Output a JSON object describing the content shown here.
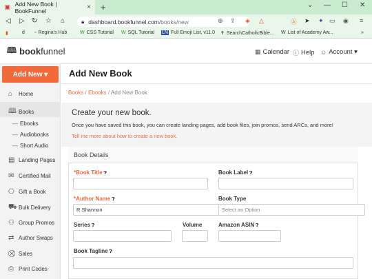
{
  "browser": {
    "tab_title": "Add New Book | BookFunnel",
    "tab_close": "×",
    "new_tab": "+",
    "url_domain": "dashboard.bookfunnel.com",
    "url_path": "/books/new",
    "window_controls": [
      "⌄",
      "—",
      "☐",
      "✕"
    ],
    "bookmarks": [
      {
        "icon": "orange-app-icon",
        "label": ""
      },
      {
        "icon": "d-icon",
        "label": "d"
      },
      {
        "icon": "bookmark-icon",
        "label": "Regina's Hub"
      },
      {
        "icon": "w-icon",
        "label": "CSS Tutorial"
      },
      {
        "icon": "w-icon",
        "label": "SQL Tutorial"
      },
      {
        "icon": "ln-icon",
        "label": "Full Emoji List, v11.0"
      },
      {
        "icon": "cross-icon",
        "label": "SearchCatholicBible..."
      },
      {
        "icon": "w-icon",
        "label": "List of Academy Aw..."
      }
    ],
    "bookmarks_more": "»"
  },
  "header": {
    "logo_bold": "book",
    "logo_light": "funnel",
    "calendar": "Calendar",
    "help": "Help",
    "account": "Account ▾"
  },
  "sidebar": {
    "add_new": "Add New ▾",
    "items": [
      {
        "label": "Home",
        "icon": "home-icon"
      },
      {
        "label": "Books",
        "icon": "book-icon"
      },
      {
        "label": "Landing Pages",
        "icon": "document-icon"
      },
      {
        "label": "Certified Mail",
        "icon": "mail-icon"
      },
      {
        "label": "Gift a Book",
        "icon": "gift-icon"
      },
      {
        "label": "Bulk Delivery",
        "icon": "truck-icon"
      },
      {
        "label": "Group Promos",
        "icon": "group-icon"
      },
      {
        "label": "Author Swaps",
        "icon": "swap-icon"
      },
      {
        "label": "Sales",
        "icon": "cart-icon"
      },
      {
        "label": "Print Codes",
        "icon": "print-icon"
      }
    ],
    "subitems": [
      "Ebooks",
      "Audiobooks",
      "Short Audio"
    ]
  },
  "main": {
    "title": "Add New Book",
    "breadcrumb": {
      "books": "Books",
      "ebooks": "Ebooks",
      "current": "Add New Book",
      "sep": "/"
    },
    "intro_title": "Create your new book.",
    "intro_text": "Once you have saved this book, you can create landing pages, add book files, join promos, send ARCs, and more!",
    "intro_link": "Tell me more about how to create a new book.",
    "panel_title": "Book Details",
    "fields": {
      "book_title": "*Book Title",
      "book_label": "Book Label",
      "author_name": "*Author Name",
      "author_value": "R Shannon",
      "book_type": "Book Type",
      "book_type_placeholder": "Select an Option",
      "series": "Series",
      "volume": "Volume",
      "asin": "Amazon ASIN",
      "tagline": "Book Tagline"
    }
  },
  "colors": {
    "accent": "#f26a3b",
    "link": "#e86a3d",
    "chrome": "#e8f7ea"
  }
}
